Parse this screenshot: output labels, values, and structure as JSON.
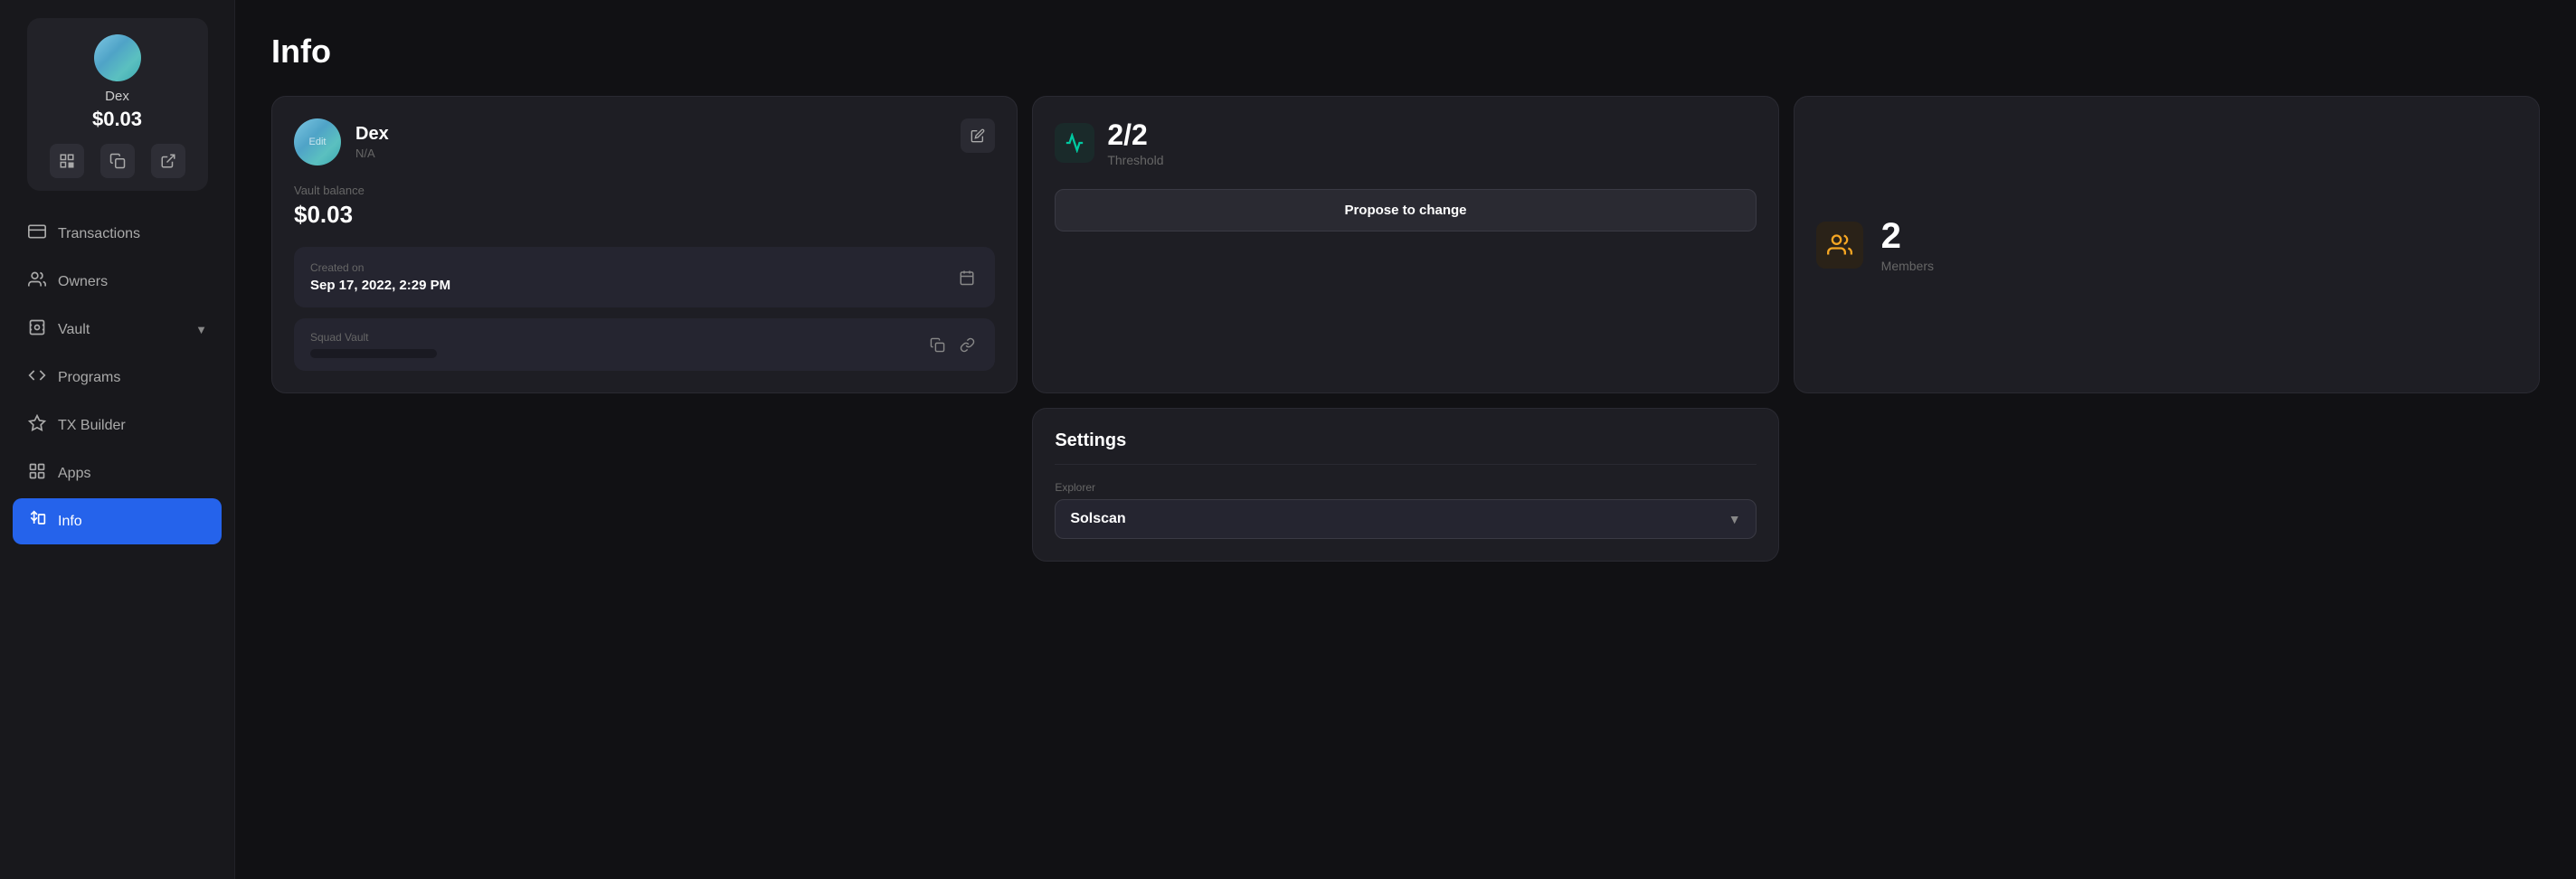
{
  "sidebar": {
    "wallet": {
      "name": "Dex",
      "balance": "$0.03"
    },
    "nav_items": [
      {
        "id": "transactions",
        "label": "Transactions",
        "icon": "card"
      },
      {
        "id": "owners",
        "label": "Owners",
        "icon": "people"
      },
      {
        "id": "vault",
        "label": "Vault",
        "icon": "vault",
        "has_chevron": true
      },
      {
        "id": "programs",
        "label": "Programs",
        "icon": "code"
      },
      {
        "id": "tx-builder",
        "label": "TX Builder",
        "icon": "settings"
      },
      {
        "id": "apps",
        "label": "Apps",
        "icon": "apps"
      },
      {
        "id": "info",
        "label": "Info",
        "icon": "info",
        "active": true
      }
    ]
  },
  "page": {
    "title": "Info"
  },
  "dex_card": {
    "name": "Dex",
    "sub": "N/A",
    "vault_balance_label": "Vault balance",
    "vault_balance": "$0.03",
    "created_label": "Created on",
    "created_value": "Sep 17, 2022, 2:29 PM",
    "squad_vault_label": "Squad Vault"
  },
  "threshold_card": {
    "value": "2/2",
    "label": "Threshold",
    "propose_btn": "Propose to change"
  },
  "members_card": {
    "value": "2",
    "label": "Members"
  },
  "settings_card": {
    "title": "Settings",
    "explorer_label": "Explorer",
    "explorer_value": "Solscan"
  }
}
